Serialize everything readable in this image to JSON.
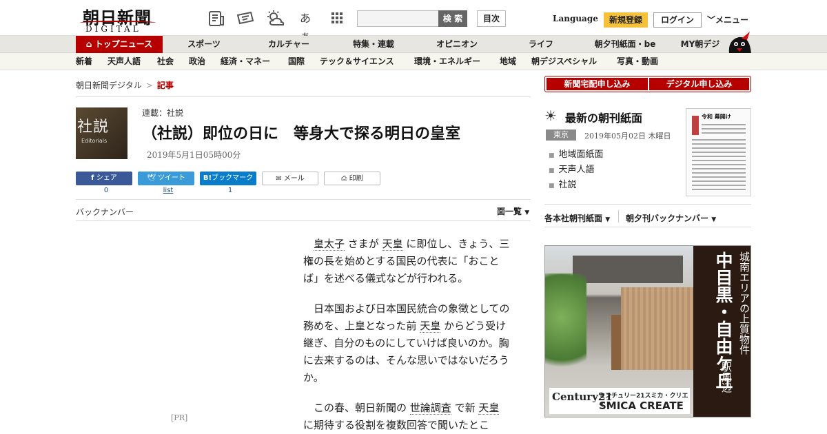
{
  "header": {
    "logo_main": "朝日新聞",
    "logo_sub": "DIGITAL",
    "search_button": "検 索",
    "toc_button": "目次",
    "font_size_icon_label": "あぁ",
    "language": "Language",
    "register": "新規登録",
    "login": "ログイン",
    "menu": "メニュー"
  },
  "nav_primary": [
    "トップニュース",
    "スポーツ",
    "カルチャー",
    "特集・連載",
    "オピニオン",
    "ライフ",
    "朝夕刊紙面・be",
    "MY朝デジ"
  ],
  "nav_secondary": [
    "新着",
    "天声人語",
    "社会",
    "政治",
    "経済・マネー",
    "国際",
    "テック＆サイエンス",
    "環境・エネルギー",
    "地域",
    "朝デジスペシャル",
    "写真・動画"
  ],
  "breadcrumb": {
    "home": "朝日新聞デジタル",
    "separator": ">",
    "current": "記事"
  },
  "article": {
    "thumb_main": "社説",
    "thumb_sub": "Editorials",
    "series": "連載：社説",
    "title": "（社説）即位の日に　等身大で探る明日の皇室",
    "date": "2019年5月1日05時00分"
  },
  "share": {
    "facebook": {
      "label": "シェア",
      "count": "0"
    },
    "twitter": {
      "label": "ツイート",
      "count": "list"
    },
    "hatena": {
      "label": "ブックマーク",
      "count": "1"
    },
    "mail": {
      "label": "メール"
    },
    "print": {
      "label": "印刷"
    }
  },
  "backnumber": "バックナンバー",
  "menhitoran": "面一覧",
  "pr": "[PR]",
  "body": {
    "p1_kw1": "皇太子",
    "p1_a": "さまが",
    "p1_kw2": "天皇",
    "p1_b": "に即位し、きょう、三権の長を始めとする国民の代表に「おことば」を述べる儀式などが行われる。",
    "p2_a": "日本国および日本国民統合の象徴としての務めを、上皇となった前",
    "p2_kw": "天皇",
    "p2_b": "からどう受け継ぎ、自分のものにしていけば良いのか。胸に去来するのは、そんな思いではないだろうか。",
    "p3_a": "この春、朝日新聞の",
    "p3_kw1": "世論調査",
    "p3_b": "で新",
    "p3_kw2": "天皇",
    "p3_c": "に期待する役割を複数回答で聞いたとこ"
  },
  "sidebar": {
    "apply_home": "新聞宅配申し込み",
    "apply_digital": "デジタル申し込み",
    "paper_title": "最新の朝刊紙面",
    "region": "東京",
    "paper_date": "2019年05月02日 木曜日",
    "links": [
      "地域面紙面",
      "天声人語",
      "社説"
    ],
    "paper_headline": "令和 幕開け",
    "select_regional": "各本社朝刊紙面",
    "select_backnumber": "朝夕刊バックナンバー"
  },
  "ad": {
    "brand": "Century21",
    "company_small": "センチュリー21スミカ・クリエイト",
    "company_large": "SMICA CREATE",
    "copy_small": "城南エリアの上質物件",
    "copy_large": "中目黒・自由ケ丘",
    "copy_tail": "駅周辺"
  },
  "colors": {
    "brand_red": "#b60000",
    "register_yellow": "#f5c13a",
    "facebook": "#3b5998",
    "twitter": "#3a9bd8",
    "hatena": "#0a7dca"
  }
}
